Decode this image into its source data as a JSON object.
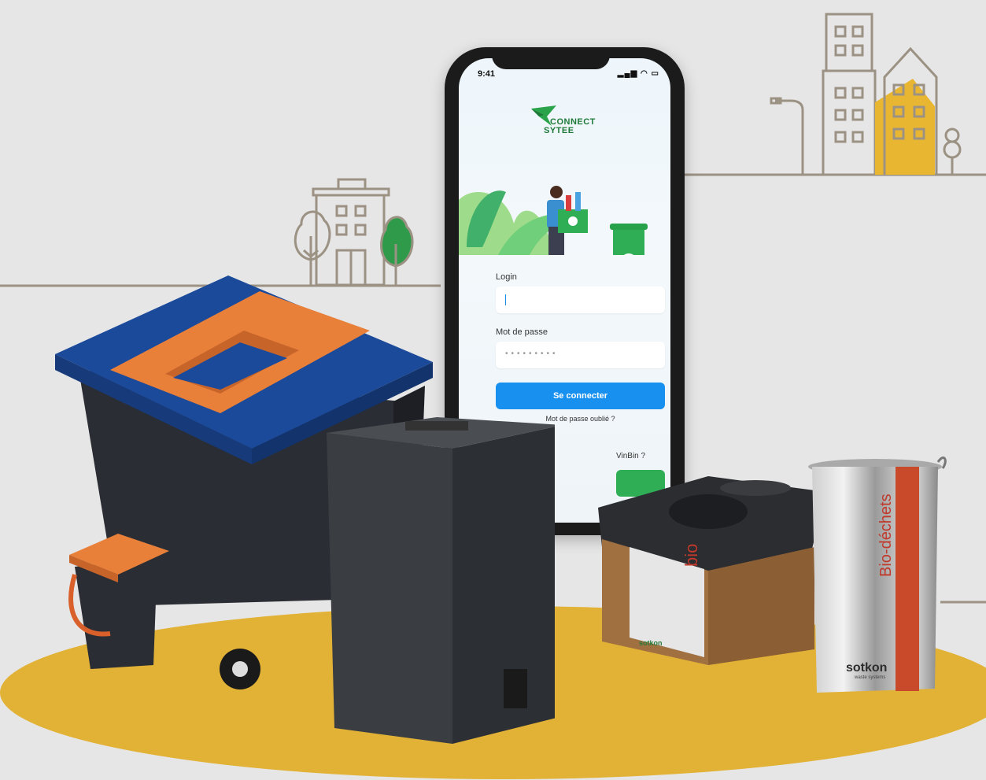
{
  "phone": {
    "status_time": "9:41",
    "status_icons": "signal-wifi-battery",
    "app_name_line1": "CONNECT",
    "app_name_line2": "SYTEE",
    "login_label": "Login",
    "login_value": "",
    "password_label": "Mot de passe",
    "password_value": "•••••••••",
    "submit_label": "Se connecter",
    "forgot_label": "Mot de passe oublié ?",
    "winbin_partial": "VinBin ?"
  },
  "products": {
    "bin_bio_label": "bio",
    "brand_sotkon": "sotkon",
    "brand_sotkon_small": "sotkon",
    "bucket_label": "Bio-déchets",
    "brand_sotkon_bucket": "sotkon",
    "brand_sotkon_bucket_sub": "waste systems"
  },
  "colors": {
    "background": "#e6e6e6",
    "stage": "#e2b236",
    "accent_blue": "#1890f0",
    "accent_green": "#2fae55",
    "bin_blue": "#1c4a9a",
    "bin_orange": "#e9803a"
  }
}
